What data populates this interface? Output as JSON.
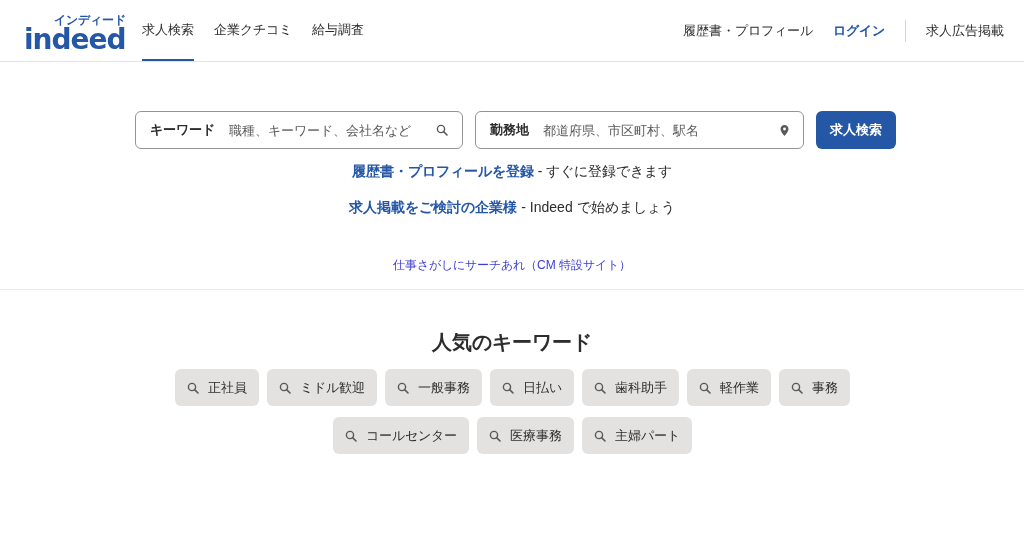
{
  "logo": {
    "text": "indeed",
    "kana": "インディード"
  },
  "nav_tabs": [
    {
      "label": "求人検索",
      "selected": true
    },
    {
      "label": "企業クチコミ",
      "selected": false
    },
    {
      "label": "給与調査",
      "selected": false
    }
  ],
  "header_links": [
    {
      "label": "履歴書・プロフィール",
      "kind": "link"
    },
    {
      "label": "ログイン",
      "kind": "login"
    },
    {
      "label": "求人広告掲載",
      "kind": "employer"
    }
  ],
  "search": {
    "keyword": {
      "label": "キーワード",
      "placeholder": "職種、キーワード、会社名など"
    },
    "location": {
      "label": "勤務地",
      "placeholder": "都道府県、市区町村、駅名"
    },
    "button": "求人検索"
  },
  "promos": [
    {
      "link": "履歴書・プロフィールを登録",
      "text": "- すぐに登録できます"
    },
    {
      "link": "求人掲載をご検討の企業様",
      "text": "- Indeed で始めましょう"
    }
  ],
  "cm_link": "仕事さがしにサーチあれ（CM 特設サイト）",
  "popular": {
    "title": "人気のキーワード",
    "keywords": [
      "正社員",
      "ミドル歓迎",
      "一般事務",
      "日払い",
      "歯科助手",
      "軽作業",
      "事務",
      "コールセンター",
      "医療事務",
      "主婦パート"
    ]
  }
}
